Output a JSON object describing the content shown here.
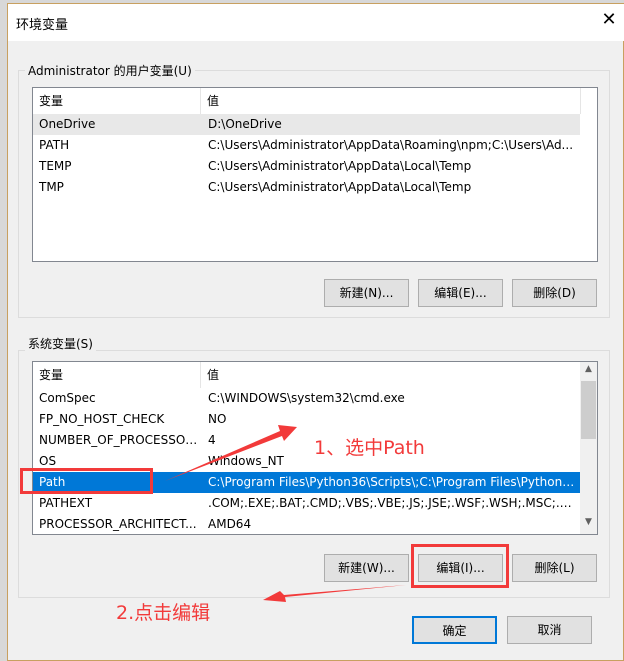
{
  "dialog": {
    "title": "环境变量",
    "close_icon": "close-icon"
  },
  "user_vars": {
    "label": "Administrator 的用户变量(U)",
    "columns": [
      "变量",
      "值"
    ],
    "rows": [
      {
        "name": "OneDrive",
        "value": "D:\\OneDrive"
      },
      {
        "name": "PATH",
        "value": "C:\\Users\\Administrator\\AppData\\Roaming\\npm;C:\\Users\\Ad..."
      },
      {
        "name": "TEMP",
        "value": "C:\\Users\\Administrator\\AppData\\Local\\Temp"
      },
      {
        "name": "TMP",
        "value": "C:\\Users\\Administrator\\AppData\\Local\\Temp"
      }
    ],
    "buttons": {
      "new": "新建(N)...",
      "edit": "编辑(E)...",
      "delete": "删除(D)"
    }
  },
  "sys_vars": {
    "label": "系统变量(S)",
    "columns": [
      "变量",
      "值"
    ],
    "rows": [
      {
        "name": "ComSpec",
        "value": "C:\\WINDOWS\\system32\\cmd.exe"
      },
      {
        "name": "FP_NO_HOST_CHECK",
        "value": "NO"
      },
      {
        "name": "NUMBER_OF_PROCESSORS",
        "value": "4"
      },
      {
        "name": "OS",
        "value": "Windows_NT"
      },
      {
        "name": "Path",
        "value": "C:\\Program Files\\Python36\\Scripts\\;C:\\Program Files\\Python3...",
        "selected": true
      },
      {
        "name": "PATHEXT",
        "value": ".COM;.EXE;.BAT;.CMD;.VBS;.VBE;.JS;.JSE;.WSF;.WSH;.MSC;.PY;.P..."
      },
      {
        "name": "PROCESSOR_ARCHITECT...",
        "value": "AMD64"
      }
    ],
    "buttons": {
      "new": "新建(W)...",
      "edit": "编辑(I)...",
      "delete": "删除(L)"
    }
  },
  "footer": {
    "ok": "确定",
    "cancel": "取消"
  },
  "annotations": {
    "step1": "1、选中Path",
    "step2": "2.点击编辑",
    "color": "#f23a3a"
  },
  "colors": {
    "selection": "#0078d7",
    "accent_border": "#0078d7"
  }
}
